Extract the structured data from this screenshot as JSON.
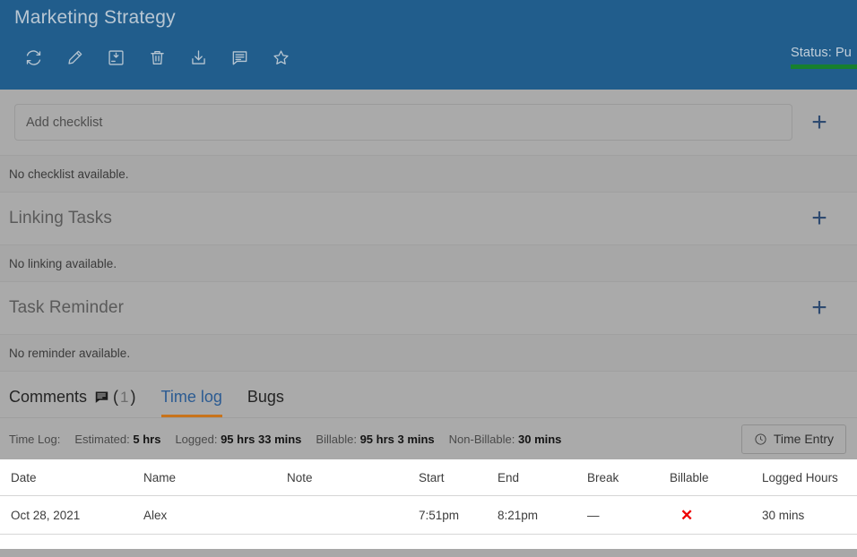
{
  "header": {
    "title": "Marketing Strategy",
    "toolbar": [
      {
        "name": "refresh-icon",
        "label": "Refresh"
      },
      {
        "name": "edit-icon",
        "label": "Edit"
      },
      {
        "name": "save-icon",
        "label": "Save"
      },
      {
        "name": "delete-icon",
        "label": "Delete"
      },
      {
        "name": "download-icon",
        "label": "Download"
      },
      {
        "name": "note-icon",
        "label": "Note"
      },
      {
        "name": "star-icon",
        "label": "Favorite"
      }
    ],
    "status": {
      "label": "Status:",
      "value": "Pu",
      "full_text": "Status: Pu",
      "underline_color": "#17802e"
    }
  },
  "checklist": {
    "input_placeholder": "Add checklist",
    "input_value": "",
    "add_label": "+",
    "empty_text": "No checklist available."
  },
  "linking": {
    "title": "Linking Tasks",
    "add_label": "+",
    "empty_text": "No linking available."
  },
  "reminder": {
    "title": "Task Reminder",
    "add_label": "+",
    "empty_text": "No reminder available."
  },
  "tabs": [
    {
      "label": "Comments",
      "count": "1",
      "has_icon": true,
      "active": false
    },
    {
      "label": "Time log",
      "count": "",
      "has_icon": false,
      "active": true
    },
    {
      "label": "Bugs",
      "count": "",
      "has_icon": false,
      "active": false
    }
  ],
  "timelog_summary": {
    "prefix": "Time Log:",
    "stats": [
      {
        "key": "Estimated:",
        "value": "5 hrs"
      },
      {
        "key": "Logged:",
        "value": "95 hrs 33 mins"
      },
      {
        "key": "Billable:",
        "value": "95 hrs 3 mins"
      },
      {
        "key": "Non-Billable:",
        "value": "30 mins"
      }
    ],
    "time_entry_button": "Time Entry"
  },
  "timelog_table": {
    "columns": [
      "Date",
      "Name",
      "Note",
      "Start",
      "End",
      "Break",
      "Billable",
      "Logged Hours"
    ],
    "rows": [
      {
        "date": "Oct 28, 2021",
        "name": "Alex",
        "note": "",
        "start": "7:51pm",
        "end": "8:21pm",
        "break": "—",
        "billable": "✕",
        "logged_hours": "30 mins"
      }
    ]
  },
  "colors": {
    "header_blue": "#215d8c",
    "overlay_gray": "#aaaaaa",
    "accent_orange": "#c8741b",
    "tab_active_blue": "#2b5b92",
    "plus_navy": "#2e4a70",
    "status_green": "#17802e",
    "billable_red": "#ee0000"
  }
}
